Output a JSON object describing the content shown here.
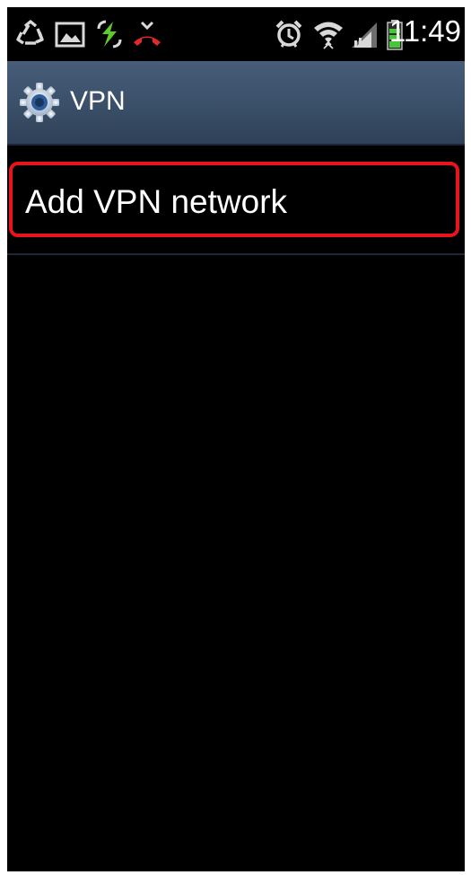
{
  "status_bar": {
    "time": "11:49",
    "icons": [
      "recycle-icon",
      "gallery-icon",
      "data-sync-icon",
      "missed-call-icon",
      "alarm-icon",
      "wifi-icon",
      "signal-icon",
      "battery-icon"
    ],
    "colors": {
      "sync": "#5fc92e",
      "missed_call": "#e22a2a",
      "battery": "#47c637",
      "icon_default": "#d8d8d8"
    }
  },
  "header": {
    "title": "VPN",
    "icon": "gear-icon",
    "background": "#3e5470"
  },
  "list": {
    "items": [
      {
        "label": "Add VPN network"
      }
    ],
    "highlight_color": "#e8141c"
  }
}
